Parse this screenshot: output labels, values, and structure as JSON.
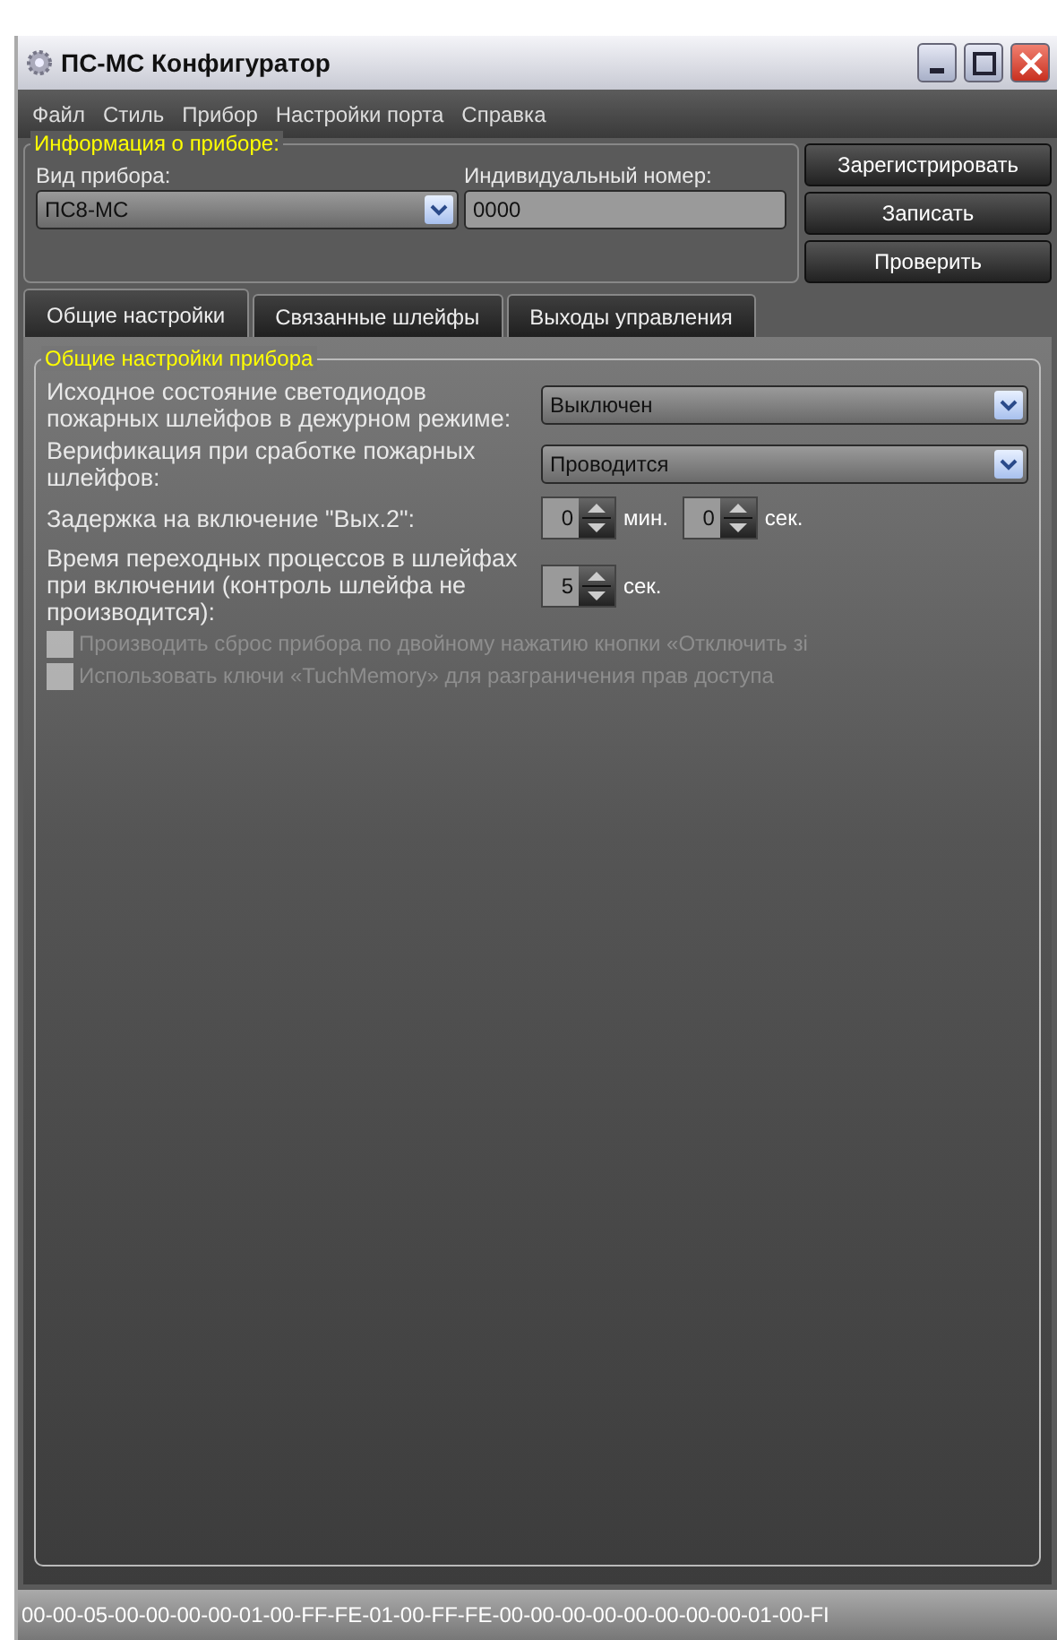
{
  "window": {
    "title": "ПС-МС Конфигуратор"
  },
  "menu": [
    "Файл",
    "Стиль",
    "Прибор",
    "Настройки порта",
    "Справка"
  ],
  "device_info": {
    "legend": "Информация о приборе:",
    "type_label": "Вид прибора:",
    "type_value": "ПС8-МС",
    "serial_label": "Индивидуальный номер:",
    "serial_value": "0000"
  },
  "buttons": [
    "Зарегистрировать",
    "Записать",
    "Проверить"
  ],
  "tabs": [
    {
      "label": "Общие настройки",
      "selected": true
    },
    {
      "label": "Связанные шлейфы",
      "selected": false
    },
    {
      "label": "Выходы управления",
      "selected": false
    }
  ],
  "settings": {
    "legend": "Общие настройки прибора",
    "rows": [
      {
        "kind": "select",
        "label": "Исходное состояние светодиодов пожарных шлейфов в дежурном режиме:",
        "value": "Выключен"
      },
      {
        "kind": "select",
        "label": "Верификация при сработке пожарных шлейфов:",
        "value": "Проводится"
      },
      {
        "kind": "spins",
        "label": "Задержка на включение \"Вых.2\":",
        "spins": [
          {
            "value": "0",
            "unit": "мин."
          },
          {
            "value": "0",
            "unit": "сек."
          }
        ]
      },
      {
        "kind": "spins",
        "label": "Время переходных процессов в шлейфах при включении (контроль шлейфа не производится):",
        "spins": [
          {
            "value": "5",
            "unit": "сек."
          }
        ]
      },
      {
        "kind": "check",
        "label": "Производить сброс прибора по двойному нажатию кнопки «Отключить зі",
        "checked": false,
        "disabled": true
      },
      {
        "kind": "check",
        "label": "Использовать  ключи «TuchMemory» для разграничения прав доступа",
        "checked": false,
        "disabled": true
      }
    ]
  },
  "status_bar": "00-00-05-00-00-00-00-01-00-FF-FE-01-00-FF-FE-00-00-00-00-00-00-00-00-01-00-FI"
}
